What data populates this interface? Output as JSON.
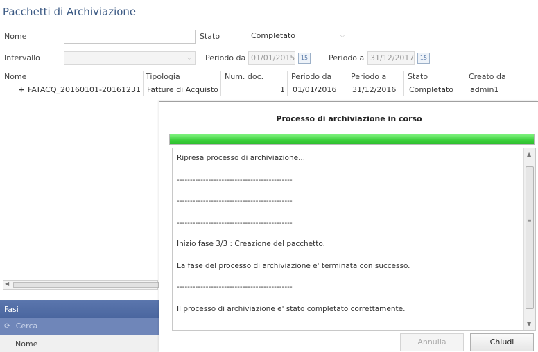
{
  "page": {
    "title": "Pacchetti di Archiviazione"
  },
  "filters": {
    "nome_label": "Nome",
    "nome_value": "",
    "stato_label": "Stato",
    "stato_value": "Completato",
    "intervallo_label": "Intervallo",
    "intervallo_value": "",
    "periodo_da_label": "Periodo da",
    "periodo_da_value": "01/01/2015",
    "periodo_a_label": "Periodo a",
    "periodo_a_value": "31/12/2017",
    "calendar_day": "15"
  },
  "grid": {
    "columns": [
      "Nome",
      "Tipologia",
      "Num. doc.",
      "Periodo da",
      "Periodo a",
      "Stato",
      "Creato da"
    ],
    "rows": [
      {
        "expander": "+",
        "nome": "FATACQ_20160101-20161231",
        "tipologia": "Fatture di Acquisto",
        "num_doc": "1",
        "periodo_da": "01/01/2016",
        "periodo_a": "31/12/2016",
        "stato": "Completato",
        "creato_da": "admin1"
      }
    ]
  },
  "dialog": {
    "title": "Processo di archiviazione in corso",
    "progress": 1.0,
    "progress_color": "#3bcf3b",
    "log": [
      "Ripresa processo di archiviazione...",
      "--------------------------------------------",
      "--------------------------------------------",
      "--------------------------------------------",
      "Inizio fase 3/3 : Creazione del pacchetto.",
      "La fase del processo di archiviazione e' terminata con successo.",
      "--------------------------------------------",
      "Il processo di archiviazione e' stato completato correttamente."
    ],
    "annulla_label": "Annulla",
    "chiudi_label": "Chiudi"
  },
  "lower_panel": {
    "fasi_label": "Fasi",
    "cerca_label": "Cerca",
    "nome_label": "Nome"
  },
  "icons": {
    "dropdown": "chevron-down-icon",
    "calendar": "calendar-icon",
    "search": "search-icon",
    "expand": "plus-icon"
  },
  "colors": {
    "title": "#3c5a84",
    "fasi_bar": "#4a669f",
    "cerca_bar": "#6f86b9"
  }
}
